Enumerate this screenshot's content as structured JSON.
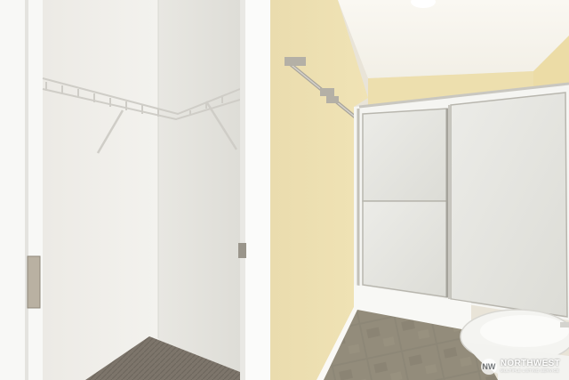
{
  "photo": {
    "subject": "bathroom-with-walk-in-closet",
    "colors": {
      "wall_yellow": "#efe2b2",
      "closet_wall": "#f1f0ec",
      "door_trim": "#fbfbfa",
      "ceiling": "#f7f4ec",
      "tile": "#8b8574",
      "carpet": "#7f776d",
      "shower_glass": "#e6e6e1"
    }
  },
  "watermark": {
    "logo_icon": "northwest-mls-logo-icon",
    "logo_letters": "NW",
    "name": "NORTHWEST",
    "tagline": "MULTIPLE LISTING SERVICE"
  }
}
